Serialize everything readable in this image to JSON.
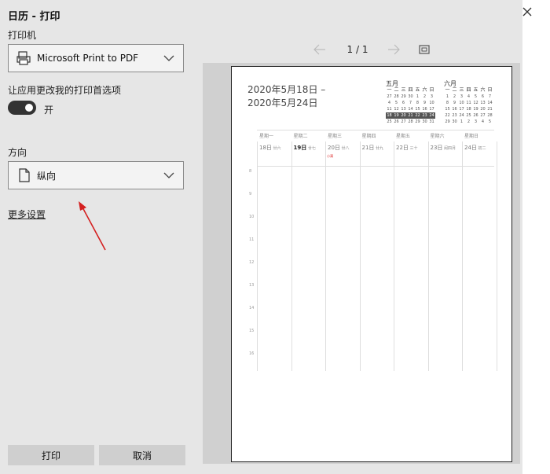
{
  "dialog": {
    "title": "日历 - 打印",
    "printer_label": "打印机",
    "printer_value": "Microsoft Print to PDF",
    "prefs_label": "让应用更改我的打印首选项",
    "toggle_text": "开",
    "orientation_label": "方向",
    "orientation_value": "纵向",
    "more_settings": "更多设置",
    "print_button": "打印",
    "cancel_button": "取消"
  },
  "preview": {
    "page_indicator": "1 / 1",
    "range_line1": "2020年5月18日 –",
    "range_line2": "2020年5月24日",
    "may": {
      "label": "五月",
      "weekdays": [
        "一",
        "二",
        "三",
        "四",
        "五",
        "六",
        "日"
      ],
      "days": [
        "27",
        "28",
        "29",
        "30",
        "1",
        "2",
        "3",
        "4",
        "5",
        "6",
        "7",
        "8",
        "9",
        "10",
        "11",
        "12",
        "13",
        "14",
        "15",
        "16",
        "17",
        "18",
        "19",
        "20",
        "21",
        "22",
        "23",
        "24",
        "25",
        "26",
        "27",
        "28",
        "29",
        "30",
        "31"
      ]
    },
    "june": {
      "label": "六月",
      "weekdays": [
        "一",
        "二",
        "三",
        "四",
        "五",
        "六",
        "日"
      ],
      "days": [
        "1",
        "2",
        "3",
        "4",
        "5",
        "6",
        "7",
        "8",
        "9",
        "10",
        "11",
        "12",
        "13",
        "14",
        "15",
        "16",
        "17",
        "18",
        "19",
        "20",
        "21",
        "22",
        "23",
        "24",
        "25",
        "26",
        "27",
        "28",
        "29",
        "30",
        "1",
        "2",
        "3",
        "4",
        "5"
      ]
    },
    "week": [
      {
        "head": "星期一",
        "date": "18日",
        "lunar": "廿六"
      },
      {
        "head": "星期二",
        "date": "19日",
        "lunar": "廿七"
      },
      {
        "head": "星期三",
        "date": "20日",
        "lunar": "廿八"
      },
      {
        "head": "星期四",
        "date": "21日",
        "lunar": "廿九"
      },
      {
        "head": "星期五",
        "date": "22日",
        "lunar": "三十"
      },
      {
        "head": "星期六",
        "date": "23日",
        "lunar": "闰四月"
      },
      {
        "head": "星期日",
        "date": "24日",
        "lunar": "初二"
      }
    ],
    "festival": "小满",
    "hours": [
      "8",
      "9",
      "10",
      "11",
      "12",
      "13",
      "14",
      "15",
      "16"
    ]
  },
  "colors": {
    "panel_bg": "#e6e6e6",
    "button_bg": "#cfcfcf",
    "annotation_arrow": "#d42020",
    "selected_week": "#555555"
  }
}
